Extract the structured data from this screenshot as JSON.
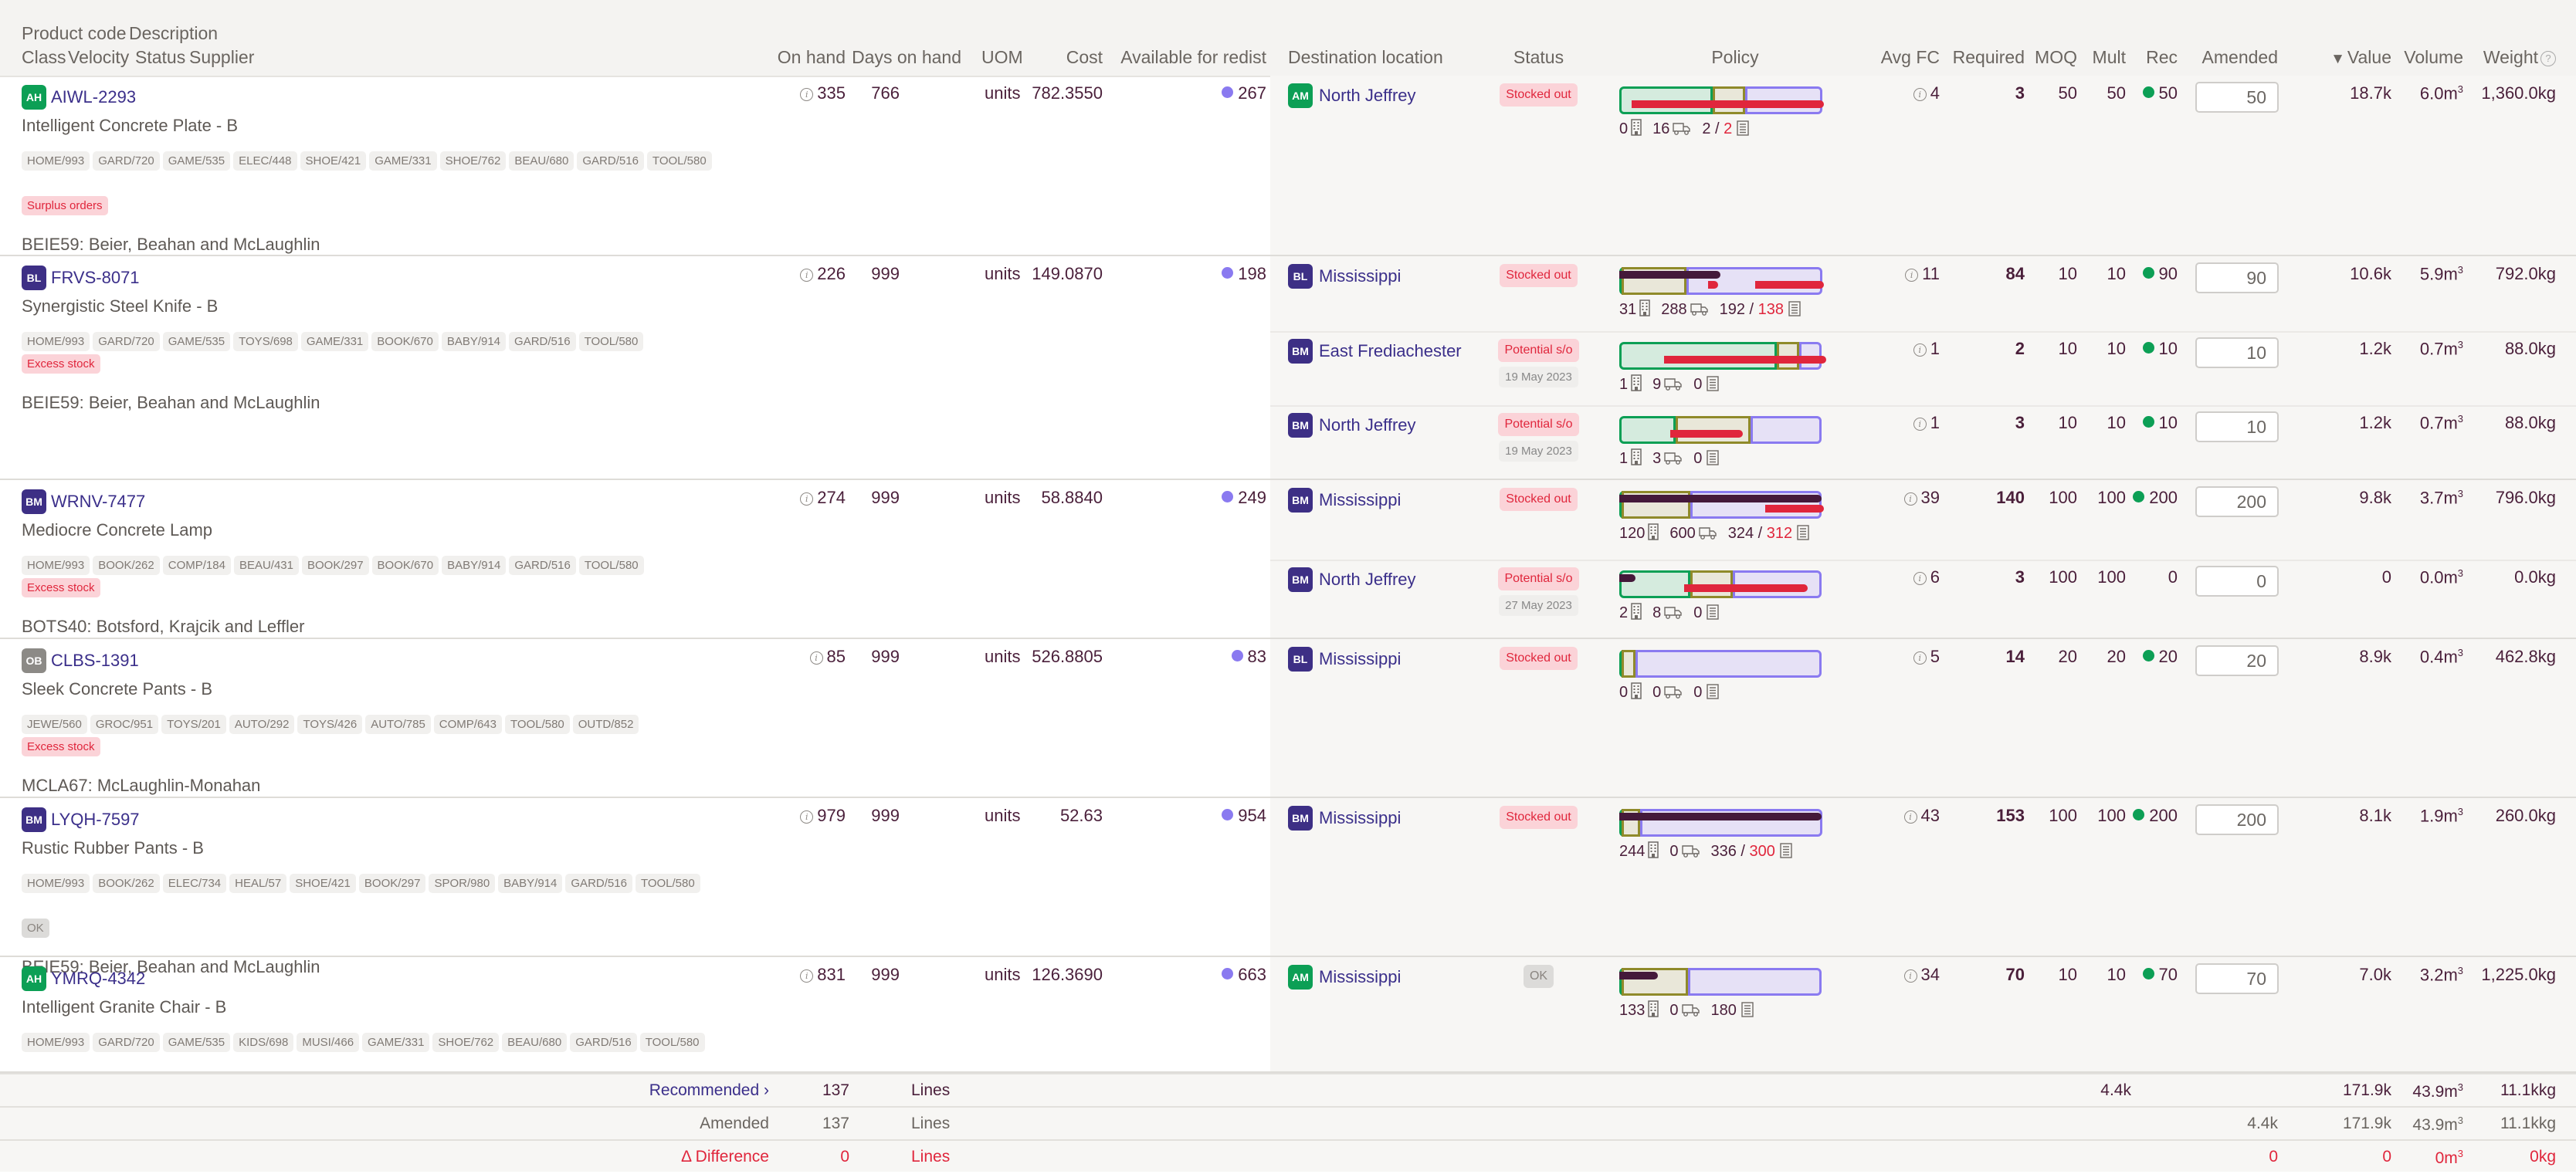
{
  "colors": {
    "accent_purple": "#3b2f8a",
    "class_green": "#0c9f55",
    "class_purple": "#3d2f85",
    "class_grey": "#8c8a86",
    "alert_red": "#e0263c",
    "available_dot": "#8a7af0",
    "rec_dot": "#0c9f55",
    "policy_green": "#0c9f55",
    "policy_olive": "#8f8a2a",
    "policy_purple": "#8a7af0",
    "onhand_bar": "#44193a"
  },
  "header": {
    "line1": {
      "product_code": "Product code",
      "description": "Description"
    },
    "line2": {
      "class": "Class",
      "velocity": "Velocity",
      "status": "Status",
      "supplier": "Supplier"
    },
    "on_hand": "On hand",
    "days_on_hand": "Days on hand",
    "uom": "UOM",
    "cost": "Cost",
    "available": "Available for redist",
    "destination": "Destination location",
    "status_col": "Status",
    "policy": "Policy",
    "avg_fc": "Avg FC",
    "required": "Required",
    "moq": "MOQ",
    "mult": "Mult",
    "rec": "Rec",
    "amended": "Amended",
    "value": "Value",
    "value_sort": "▼",
    "volume": "Volume",
    "weight": "Weight",
    "weight_help": "?"
  },
  "products": [
    {
      "class": "AH",
      "class_color": "green",
      "code": "AIWL-2293",
      "description": "Intelligent Concrete Plate - B",
      "tags": [
        "HOME/993",
        "GARD/720",
        "GAME/535",
        "ELEC/448",
        "SHOE/421",
        "GAME/331",
        "SHOE/762",
        "BEAU/680",
        "GARD/516",
        "TOOL/580"
      ],
      "flag": "Surplus orders",
      "flag_type": "red",
      "supplier": "BEIE59: Beier, Beahan and McLaughlin",
      "on_hand": "335",
      "days_on_hand": "766",
      "uom": "units",
      "cost": "782.3550",
      "available": "267",
      "destinations": [
        {
          "class": "AM",
          "class_color": "green",
          "name": "North Jeffrey",
          "status": "Stocked out",
          "status_type": "red",
          "date": "",
          "policy": {
            "green": 0.46,
            "olive": 0.16,
            "purple": 0.38,
            "onhand_bar": 0,
            "red_bars": [
              [
                0.06,
                1.01
              ]
            ]
          },
          "stock": "0",
          "transit": "16",
          "orders": "2",
          "orders_need": "2",
          "orders_red": true,
          "avg_fc": "4",
          "required": "3",
          "moq": "50",
          "mult": "50",
          "rec": "50",
          "rec_dot": true,
          "amended": "50",
          "value": "18.7k",
          "volume": "6.0",
          "weight": "1,360.0kg"
        }
      ]
    },
    {
      "class": "BL",
      "class_color": "purple",
      "code": "FRVS-8071",
      "description": "Synergistic Steel Knife - B",
      "tags": [
        "HOME/993",
        "GARD/720",
        "GAME/535",
        "TOYS/698",
        "GAME/331",
        "BOOK/670",
        "BABY/914",
        "GARD/516",
        "TOOL/580"
      ],
      "flag": "Excess stock",
      "flag_type": "red",
      "supplier": "BEIE59: Beier, Beahan and McLaughlin",
      "on_hand": "226",
      "days_on_hand": "999",
      "uom": "units",
      "cost": "149.0870",
      "available": "198",
      "destinations": [
        {
          "class": "BL",
          "class_color": "purple",
          "name": "Mississippi",
          "status": "Stocked out",
          "status_type": "red",
          "date": "",
          "policy": {
            "green": 0.01,
            "olive": 0.32,
            "purple": 0.67,
            "onhand_bar": 0.5,
            "red_bars": [
              [
                0.44,
                0.49
              ],
              [
                0.67,
                1.01
              ]
            ]
          },
          "stock": "31",
          "transit": "288",
          "orders": "192",
          "orders_need": "138",
          "orders_red": true,
          "avg_fc": "11",
          "required": "84",
          "moq": "10",
          "mult": "10",
          "rec": "90",
          "rec_dot": true,
          "amended": "90",
          "value": "10.6k",
          "volume": "5.9",
          "weight": "792.0kg"
        },
        {
          "class": "BM",
          "class_color": "purple",
          "name": "East Frediachester",
          "status": "Potential s/o",
          "status_type": "red",
          "date": "19 May 2023",
          "policy": {
            "green": 0.78,
            "olive": 0.11,
            "purple": 0.11,
            "onhand_bar": 0,
            "red_bars": [
              [
                0.22,
                1.02
              ]
            ]
          },
          "stock": "1",
          "transit": "9",
          "orders": "0",
          "orders_need": "",
          "orders_red": false,
          "avg_fc": "1",
          "required": "2",
          "moq": "10",
          "mult": "10",
          "rec": "10",
          "rec_dot": true,
          "amended": "10",
          "value": "1.2k",
          "volume": "0.7",
          "weight": "88.0kg"
        },
        {
          "class": "BM",
          "class_color": "purple",
          "name": "North Jeffrey",
          "status": "Potential s/o",
          "status_type": "red",
          "date": "19 May 2023",
          "policy": {
            "green": 0.28,
            "olive": 0.37,
            "purple": 0.35,
            "onhand_bar": 0,
            "red_bars": [
              [
                0.25,
                0.61
              ]
            ]
          },
          "stock": "1",
          "transit": "3",
          "orders": "0",
          "orders_need": "",
          "orders_red": false,
          "avg_fc": "1",
          "required": "3",
          "moq": "10",
          "mult": "10",
          "rec": "10",
          "rec_dot": true,
          "amended": "10",
          "value": "1.2k",
          "volume": "0.7",
          "weight": "88.0kg"
        }
      ]
    },
    {
      "class": "BM",
      "class_color": "purple",
      "code": "WRNV-7477",
      "description": "Mediocre Concrete Lamp",
      "tags": [
        "HOME/993",
        "BOOK/262",
        "COMP/184",
        "BEAU/431",
        "BOOK/297",
        "BOOK/670",
        "BABY/914",
        "GARD/516",
        "TOOL/580"
      ],
      "flag": "Excess stock",
      "flag_type": "red",
      "supplier": "BOTS40: Botsford, Krajcik and Leffler",
      "on_hand": "274",
      "days_on_hand": "999",
      "uom": "units",
      "cost": "58.8840",
      "available": "249",
      "destinations": [
        {
          "class": "BM",
          "class_color": "purple",
          "name": "Mississippi",
          "status": "Stocked out",
          "status_type": "red",
          "date": "",
          "policy": {
            "green": 0.01,
            "olive": 0.34,
            "purple": 0.65,
            "onhand_bar": 1.0,
            "red_bars": [
              [
                0.72,
                1.01
              ]
            ]
          },
          "stock": "120",
          "transit": "600",
          "orders": "324",
          "orders_need": "312",
          "orders_red": true,
          "avg_fc": "39",
          "required": "140",
          "moq": "100",
          "mult": "100",
          "rec": "200",
          "rec_dot": true,
          "amended": "200",
          "value": "9.8k",
          "volume": "3.7",
          "weight": "796.0kg"
        },
        {
          "class": "BM",
          "class_color": "purple",
          "name": "North Jeffrey",
          "status": "Potential s/o",
          "status_type": "red",
          "date": "27 May 2023",
          "policy": {
            "green": 0.35,
            "olive": 0.21,
            "purple": 0.44,
            "onhand_bar": 0.08,
            "red_bars": [
              [
                0.32,
                0.93
              ]
            ]
          },
          "stock": "2",
          "transit": "8",
          "orders": "0",
          "orders_need": "",
          "orders_red": false,
          "avg_fc": "6",
          "required": "3",
          "moq": "100",
          "mult": "100",
          "rec": "0",
          "rec_dot": false,
          "amended": "0",
          "value": "0",
          "volume": "0.0",
          "weight": "0.0kg"
        }
      ]
    },
    {
      "class": "OB",
      "class_color": "grey",
      "code": "CLBS-1391",
      "description": "Sleek Concrete Pants - B",
      "tags": [
        "JEWE/560",
        "GROC/951",
        "TOYS/201",
        "AUTO/292",
        "TOYS/426",
        "AUTO/785",
        "COMP/643",
        "TOOL/580",
        "OUTD/852"
      ],
      "flag": "Excess stock",
      "flag_type": "red",
      "supplier": "MCLA67: McLaughlin-Monahan",
      "on_hand": "85",
      "days_on_hand": "999",
      "uom": "units",
      "cost": "526.8805",
      "available": "83",
      "destinations": [
        {
          "class": "BL",
          "class_color": "purple",
          "name": "Mississippi",
          "status": "Stocked out",
          "status_type": "red",
          "date": "",
          "policy": {
            "green": 0.01,
            "olive": 0.07,
            "purple": 0.92,
            "onhand_bar": 0,
            "red_bars": []
          },
          "stock": "0",
          "transit": "0",
          "orders": "0",
          "orders_need": "",
          "orders_red": false,
          "avg_fc": "5",
          "required": "14",
          "moq": "20",
          "mult": "20",
          "rec": "20",
          "rec_dot": true,
          "amended": "20",
          "value": "8.9k",
          "volume": "0.4",
          "weight": "462.8kg"
        }
      ]
    },
    {
      "class": "BM",
      "class_color": "purple",
      "code": "LYQH-7597",
      "description": "Rustic Rubber Pants - B",
      "tags": [
        "HOME/993",
        "BOOK/262",
        "ELEC/734",
        "HEAL/57",
        "SHOE/421",
        "BOOK/297",
        "SPOR/980",
        "BABY/914",
        "GARD/516",
        "TOOL/580"
      ],
      "flag": "OK",
      "flag_type": "grey",
      "supplier": "BEIE59: Beier, Beahan and McLaughlin",
      "on_hand": "979",
      "days_on_hand": "999",
      "uom": "units",
      "cost": "52.63",
      "available": "954",
      "destinations": [
        {
          "class": "BM",
          "class_color": "purple",
          "name": "Mississippi",
          "status": "Stocked out",
          "status_type": "red",
          "date": "",
          "policy": {
            "green": 0.01,
            "olive": 0.09,
            "purple": 0.9,
            "onhand_bar": 1.0,
            "red_bars": []
          },
          "stock": "244",
          "transit": "0",
          "orders": "336",
          "orders_need": "300",
          "orders_red": true,
          "avg_fc": "43",
          "required": "153",
          "moq": "100",
          "mult": "100",
          "rec": "200",
          "rec_dot": true,
          "amended": "200",
          "value": "8.1k",
          "volume": "1.9",
          "weight": "260.0kg"
        }
      ]
    },
    {
      "class": "AH",
      "class_color": "green",
      "code": "YMRQ-4342",
      "description": "Intelligent Granite Chair - B",
      "tags": [
        "HOME/993",
        "GARD/720",
        "GAME/535",
        "KIDS/698",
        "MUSI/466",
        "GAME/331",
        "SHOE/762",
        "BEAU/680",
        "GARD/516",
        "TOOL/580"
      ],
      "flag": "",
      "flag_type": "",
      "supplier": "",
      "on_hand": "831",
      "days_on_hand": "999",
      "uom": "units",
      "cost": "126.3690",
      "available": "663",
      "destinations": [
        {
          "class": "AM",
          "class_color": "green",
          "name": "Mississippi",
          "status": "OK",
          "status_type": "grey",
          "date": "",
          "policy": {
            "green": 0.01,
            "olive": 0.33,
            "purple": 0.66,
            "onhand_bar": 0.19,
            "red_bars": []
          },
          "stock": "133",
          "transit": "0",
          "orders": "180",
          "orders_need": "",
          "orders_red": false,
          "avg_fc": "34",
          "required": "70",
          "moq": "10",
          "mult": "10",
          "rec": "70",
          "rec_dot": true,
          "amended": "70",
          "value": "7.0k",
          "volume": "3.2",
          "weight": "1,225.0kg"
        }
      ]
    }
  ],
  "units": {
    "volume_suffix": "m",
    "volume_exp": "3",
    "orders_sep": " / "
  },
  "footer": {
    "recommended": {
      "label": "Recommended",
      "chevron": "›",
      "lines": "137",
      "lines_label": "Lines",
      "rec_total": "4.4k",
      "value": "171.9k",
      "volume": "43.9",
      "weight": "11.1kkg"
    },
    "amended": {
      "label": "Amended",
      "lines": "137",
      "lines_label": "Lines",
      "amended_total": "4.4k",
      "value": "171.9k",
      "volume": "43.9",
      "weight": "11.1kkg"
    },
    "difference": {
      "label": "Δ Difference",
      "lines": "0",
      "lines_label": "Lines",
      "amended_total": "0",
      "value": "0",
      "volume": "0",
      "weight": "0kg"
    }
  }
}
